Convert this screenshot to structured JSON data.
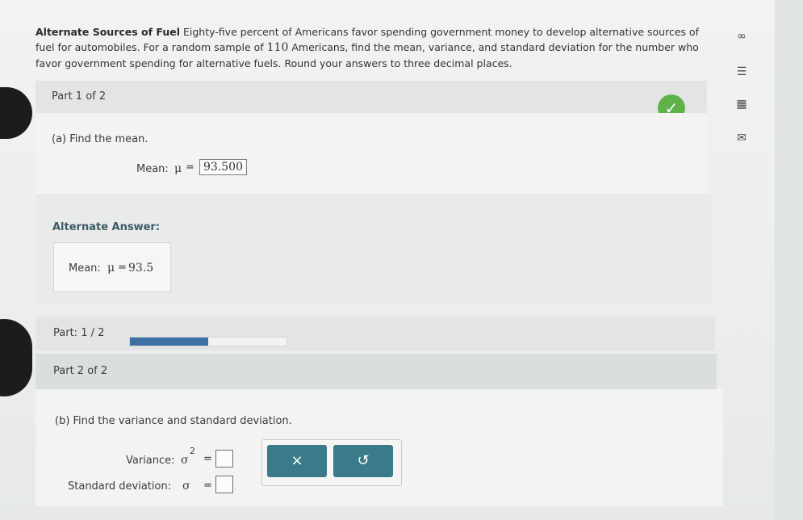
{
  "problem": {
    "title": "Alternate Sources of Fuel",
    "text_1": " Eighty-five percent of Americans favor spending government money to develop alternative sources of fuel for automobiles. For a random sample of ",
    "sample_size": "110",
    "text_2": " Americans, find the mean, variance, and standard deviation for the number who favor government spending for alternative fuels. Round your answers to three decimal places."
  },
  "side_icons": [
    "infinity-icon",
    "notes-icon",
    "calculator-icon",
    "mail-icon"
  ],
  "side_glyphs": {
    "infinity": "∞",
    "notes": "☰",
    "calculator": "▦",
    "mail": "✉"
  },
  "part1": {
    "header": "Part 1 of 2",
    "status": "✓",
    "question": "(a) Find the mean.",
    "mean_label": "Mean:",
    "mu": "μ",
    "equals": "=",
    "mean_value": "93.500"
  },
  "alternate": {
    "title": "Alternate Answer:",
    "mean_label": "Mean:",
    "mu": "μ",
    "equals": "=",
    "value": "93.5"
  },
  "progress": {
    "label": "Part:",
    "current": "1 / 2",
    "fraction": 0.5
  },
  "part2": {
    "header": "Part 2 of 2",
    "question": "(b) Find the variance and standard deviation.",
    "variance_label": "Variance:",
    "sigma_sq": "σ",
    "exponent": "2",
    "equals": "=",
    "sd_label": "Standard deviation:",
    "sigma": "σ"
  },
  "tools": {
    "clear": "×",
    "undo": "↺"
  },
  "colors": {
    "check": "#5fb24a",
    "progress": "#3f6fa5",
    "tool_button": "#3a7b8a"
  }
}
